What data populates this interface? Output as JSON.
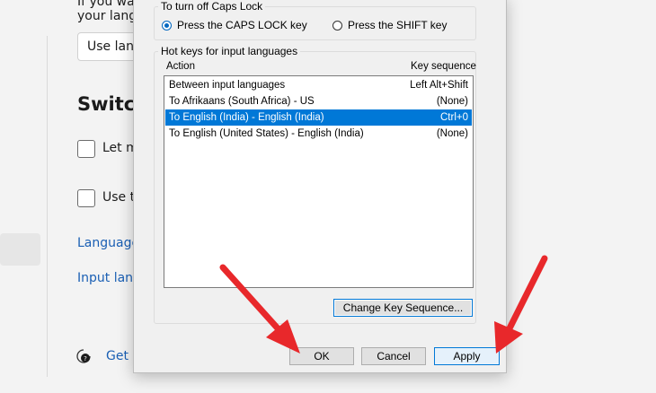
{
  "background": {
    "top_text": "If you wa\nyour langu",
    "dropdown_value": "Use lang",
    "heading": "Switchi",
    "checkbox1_label": "Let m",
    "checkbox2_label": "Use th",
    "link1": "Language",
    "link2": "Input lang",
    "help_link": "Get h"
  },
  "dialog": {
    "caps_group_title": "To turn off Caps Lock",
    "radio_caps": "Press the CAPS LOCK key",
    "radio_shift": "Press the SHIFT key",
    "hotkeys_group_title": "Hot keys for input languages",
    "col_action": "Action",
    "col_key_sequence": "Key sequence",
    "rows": [
      {
        "action": "Between input languages",
        "key": "Left Alt+Shift"
      },
      {
        "action": "To Afrikaans (South Africa) - US",
        "key": "(None)"
      },
      {
        "action": "To English (India) - English (India)",
        "key": "Ctrl+0"
      },
      {
        "action": "To English (United States) - English (India)",
        "key": "(None)"
      }
    ],
    "change_key_sequence_button": "Change Key Sequence...",
    "ok_button": "OK",
    "cancel_button": "Cancel",
    "apply_button": "Apply"
  },
  "colors": {
    "selection": "#0078d7",
    "arrow": "#e8282b",
    "link": "#1a5fb4"
  }
}
